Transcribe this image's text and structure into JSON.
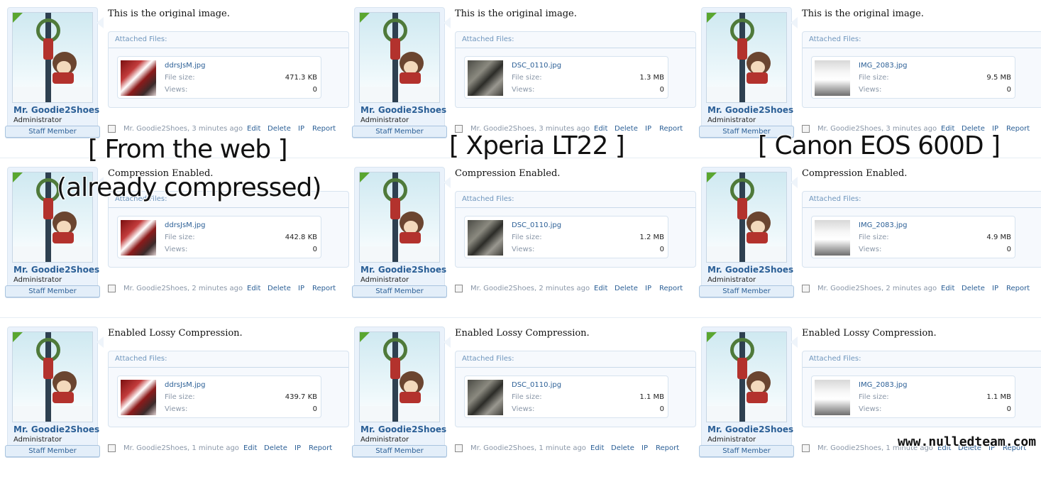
{
  "posts": [
    {
      "user": "Mr. Goodie2Shoes",
      "title": "Administrator",
      "badge": "Staff Member",
      "message": "This is the original image.",
      "attach_header": "Attached Files:",
      "filename": "ddrsJsM.jpg",
      "size_label": "File size:",
      "size": "471.3 KB",
      "views_label": "Views:",
      "views": "0",
      "meta_author": "Mr. Goodie2Shoes,",
      "time": "3 minutes ago",
      "edit": "Edit",
      "delete": "Delete",
      "ip": "IP",
      "report": "Report"
    },
    {
      "user": "Mr. Goodie2Shoes",
      "title": "Administrator",
      "badge": "Staff Member",
      "message": "This is the original image.",
      "attach_header": "Attached Files:",
      "filename": "DSC_0110.jpg",
      "size_label": "File size:",
      "size": "1.3 MB",
      "views_label": "Views:",
      "views": "0",
      "meta_author": "Mr. Goodie2Shoes,",
      "time": "3 minutes ago",
      "edit": "Edit",
      "delete": "Delete",
      "ip": "IP",
      "report": "Report"
    },
    {
      "user": "Mr. Goodie2Shoes",
      "title": "Administrator",
      "badge": "Staff Member",
      "message": "This is the original image.",
      "attach_header": "Attached Files:",
      "filename": "IMG_2083.jpg",
      "size_label": "File size:",
      "size": "9.5 MB",
      "views_label": "Views:",
      "views": "0",
      "meta_author": "Mr. Goodie2Shoes,",
      "time": "3 minutes ago",
      "edit": "Edit",
      "delete": "Delete",
      "ip": "IP",
      "report": "Report"
    },
    {
      "user": "Mr. Goodie2Shoes",
      "title": "Administrator",
      "badge": "Staff Member",
      "message": "Compression Enabled.",
      "attach_header": "Attached Files:",
      "filename": "ddrsJsM.jpg",
      "size_label": "File size:",
      "size": "442.8 KB",
      "views_label": "Views:",
      "views": "0",
      "meta_author": "Mr. Goodie2Shoes,",
      "time": "2 minutes ago",
      "edit": "Edit",
      "delete": "Delete",
      "ip": "IP",
      "report": "Report"
    },
    {
      "user": "Mr. Goodie2Shoes",
      "title": "Administrator",
      "badge": "Staff Member",
      "message": "Compression Enabled.",
      "attach_header": "Attached Files:",
      "filename": "DSC_0110.jpg",
      "size_label": "File size:",
      "size": "1.2 MB",
      "views_label": "Views:",
      "views": "0",
      "meta_author": "Mr. Goodie2Shoes,",
      "time": "2 minutes ago",
      "edit": "Edit",
      "delete": "Delete",
      "ip": "IP",
      "report": "Report"
    },
    {
      "user": "Mr. Goodie2Shoes",
      "title": "Administrator",
      "badge": "Staff Member",
      "message": "Compression Enabled.",
      "attach_header": "Attached Files:",
      "filename": "IMG_2083.jpg",
      "size_label": "File size:",
      "size": "4.9 MB",
      "views_label": "Views:",
      "views": "0",
      "meta_author": "Mr. Goodie2Shoes,",
      "time": "2 minutes ago",
      "edit": "Edit",
      "delete": "Delete",
      "ip": "IP",
      "report": "Report"
    },
    {
      "user": "Mr. Goodie2Shoes",
      "title": "Administrator",
      "badge": "Staff Member",
      "message": "Enabled Lossy Compression.",
      "attach_header": "Attached Files:",
      "filename": "ddrsJsM.jpg",
      "size_label": "File size:",
      "size": "439.7 KB",
      "views_label": "Views:",
      "views": "0",
      "meta_author": "Mr. Goodie2Shoes,",
      "time": "1 minute ago",
      "edit": "Edit",
      "delete": "Delete",
      "ip": "IP",
      "report": "Report"
    },
    {
      "user": "Mr. Goodie2Shoes",
      "title": "Administrator",
      "badge": "Staff Member",
      "message": "Enabled Lossy Compression.",
      "attach_header": "Attached Files:",
      "filename": "DSC_0110.jpg",
      "size_label": "File size:",
      "size": "1.1 MB",
      "views_label": "Views:",
      "views": "0",
      "meta_author": "Mr. Goodie2Shoes,",
      "time": "1 minute ago",
      "edit": "Edit",
      "delete": "Delete",
      "ip": "IP",
      "report": "Report"
    },
    {
      "user": "Mr. Goodie2Shoes",
      "title": "Administrator",
      "badge": "Staff Member",
      "message": "Enabled Lossy Compression.",
      "attach_header": "Attached Files:",
      "filename": "IMG_2083.jpg",
      "size_label": "File size:",
      "size": "1.1 MB",
      "views_label": "Views:",
      "views": "0",
      "meta_author": "Mr. Goodie2Shoes,",
      "time": "1 minute ago",
      "edit": "Edit",
      "delete": "Delete",
      "ip": "IP",
      "report": "Report"
    }
  ],
  "overlays": {
    "col1_line1": "[ From the web ]",
    "col1_line2": "(already compressed)",
    "col2": "[ Xperia LT22 ]",
    "col3": "[ Canon EOS 600D ]"
  },
  "watermark": "www.nulledteam.com",
  "colors": {
    "link": "#2b5f96",
    "muted": "#8a97a8",
    "badge_bg": "#e3eef9",
    "attach_bg": "#f6f9fd",
    "corner": "#5aa630"
  }
}
